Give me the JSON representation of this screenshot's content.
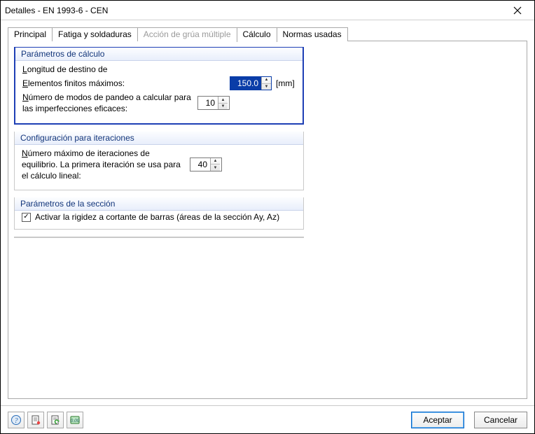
{
  "window": {
    "title": "Detalles - EN 1993-6 - CEN"
  },
  "tabs": {
    "items": [
      {
        "label": "Principal",
        "active": false,
        "disabled": false
      },
      {
        "label": "Fatiga y soldaduras",
        "active": false,
        "disabled": false
      },
      {
        "label": "Acción de grúa múltiple",
        "active": false,
        "disabled": true
      },
      {
        "label": "Cálculo",
        "active": true,
        "disabled": false
      },
      {
        "label": "Normas usadas",
        "active": false,
        "disabled": false
      }
    ]
  },
  "calc_params": {
    "title": "Parámetros de cálculo",
    "row1_label": "Longitud de destino de",
    "row2_label": "Elementos finitos máximos:",
    "row2_value": "150.0",
    "row2_unit": "[mm]",
    "row3_label": "Número de modos de pandeo a calcular para las imperfecciones eficaces:",
    "row3_value": "10"
  },
  "iter_config": {
    "title": "Configuración para iteraciones",
    "label": "Número máximo de iteraciones de equilibrio. La primera iteración se usa para el cálculo lineal:",
    "value": "40"
  },
  "section_params": {
    "title": "Parámetros de la sección",
    "checkbox_label": "Activar la rigidez a cortante de barras (áreas de la sección Ay, Az)",
    "checked": true
  },
  "footer": {
    "accept": "Aceptar",
    "cancel": "Cancelar"
  }
}
